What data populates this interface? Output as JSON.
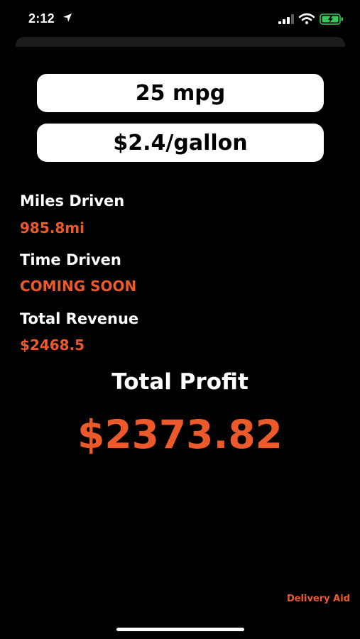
{
  "status_bar": {
    "time": "2:12",
    "icons": [
      "location-arrow-icon",
      "cellular-signal-icon",
      "wifi-icon",
      "battery-charging-icon"
    ],
    "battery_color": "#35c759"
  },
  "inputs": {
    "mpg": "25 mpg",
    "price": "$2.4/gallon"
  },
  "stats": {
    "miles_label": "Miles Driven",
    "miles_value": "985.8mi",
    "time_label": "Time Driven",
    "time_value": "COMING SOON",
    "revenue_label": "Total Revenue",
    "revenue_value": "$2468.5"
  },
  "profit": {
    "title": "Total Profit",
    "value": "$2373.82"
  },
  "branding": {
    "name": "Delivery Aid"
  },
  "colors": {
    "accent": "#ec5a2c",
    "background": "#000000",
    "field_bg": "#ffffff"
  }
}
